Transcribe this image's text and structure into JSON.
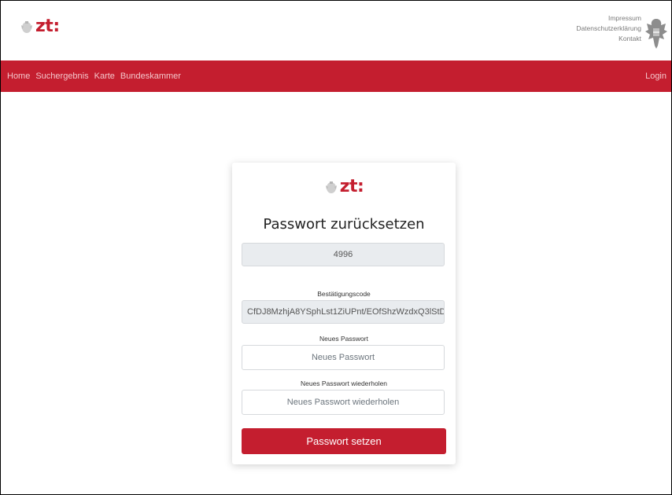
{
  "header": {
    "logo_text": "zt:",
    "links": [
      "Impressum",
      "Datenschutzerklärung",
      "Kontakt"
    ]
  },
  "nav": {
    "items": [
      "Home",
      "Suchergebnis",
      "Karte",
      "Bundeskammer"
    ],
    "login": "Login"
  },
  "form": {
    "logo_text": "zt:",
    "title": "Passwort zurücksetzen",
    "user_id_value": "4996",
    "code_label": "Bestätigungscode",
    "code_value": "CfDJ8MzhjA8YSphLst1ZiUPnt/EOfShzWzdxQ3lStD",
    "new_password_label": "Neues Passwort",
    "new_password_placeholder": "Neues Passwort",
    "repeat_password_label": "Neues Passwort wiederholen",
    "repeat_password_placeholder": "Neues Passwort wiederholen",
    "submit_label": "Passwort setzen"
  },
  "colors": {
    "brand_red": "#c41e2f",
    "readonly_bg": "#e9ecef"
  },
  "icons": {
    "small_emblem": "austrian-eagle-icon",
    "coat_of_arms": "coat-of-arms-icon"
  }
}
